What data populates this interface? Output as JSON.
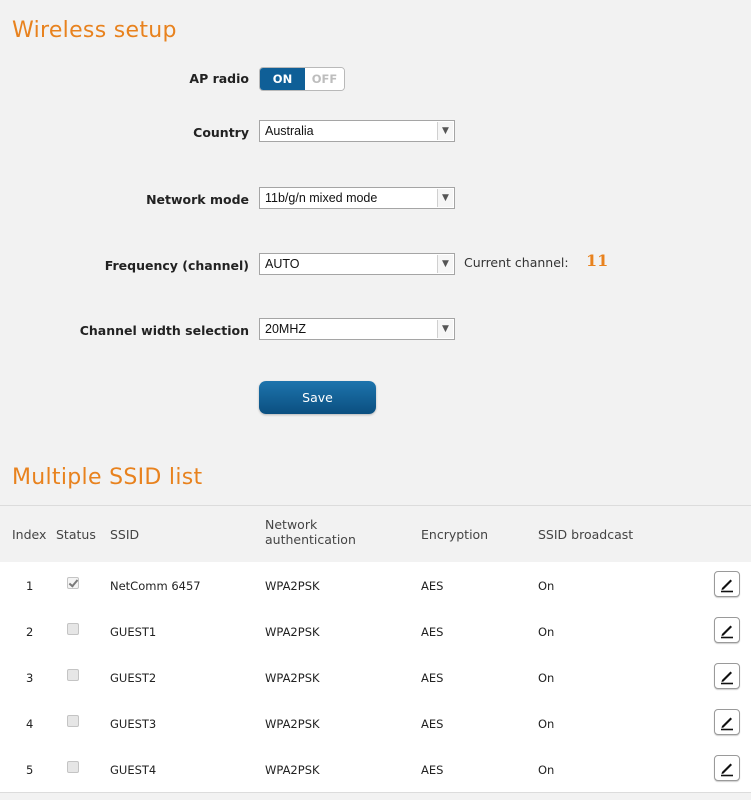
{
  "wireless_setup": {
    "title": "Wireless setup",
    "ap_radio": {
      "label": "AP radio",
      "on_label": "ON",
      "off_label": "OFF",
      "state": "ON"
    },
    "country": {
      "label": "Country",
      "value": "Australia"
    },
    "network_mode": {
      "label": "Network mode",
      "value": "11b/g/n mixed mode"
    },
    "frequency": {
      "label": "Frequency (channel)",
      "value": "AUTO",
      "current_label": "Current channel:",
      "current_value": "11"
    },
    "channel_width": {
      "label": "Channel width selection",
      "value": "20MHZ"
    },
    "save_label": "Save"
  },
  "ssid_list": {
    "title": "Multiple SSID list",
    "headers": {
      "index": "Index",
      "status": "Status",
      "ssid": "SSID",
      "auth_line1": "Network",
      "auth_line2": "authentication",
      "encryption": "Encryption",
      "broadcast": "SSID broadcast"
    },
    "rows": [
      {
        "index": "1",
        "status": true,
        "ssid": "NetComm 6457",
        "auth": "WPA2PSK",
        "encryption": "AES",
        "broadcast": "On"
      },
      {
        "index": "2",
        "status": false,
        "ssid": "GUEST1",
        "auth": "WPA2PSK",
        "encryption": "AES",
        "broadcast": "On"
      },
      {
        "index": "3",
        "status": false,
        "ssid": "GUEST2",
        "auth": "WPA2PSK",
        "encryption": "AES",
        "broadcast": "On"
      },
      {
        "index": "4",
        "status": false,
        "ssid": "GUEST3",
        "auth": "WPA2PSK",
        "encryption": "AES",
        "broadcast": "On"
      },
      {
        "index": "5",
        "status": false,
        "ssid": "GUEST4",
        "auth": "WPA2PSK",
        "encryption": "AES",
        "broadcast": "On"
      }
    ]
  },
  "colors": {
    "accent": "#e8821e",
    "button": "#0f5f97"
  },
  "icons": {
    "edit": "pencil-icon",
    "dropdown": "chevron-down-icon"
  }
}
